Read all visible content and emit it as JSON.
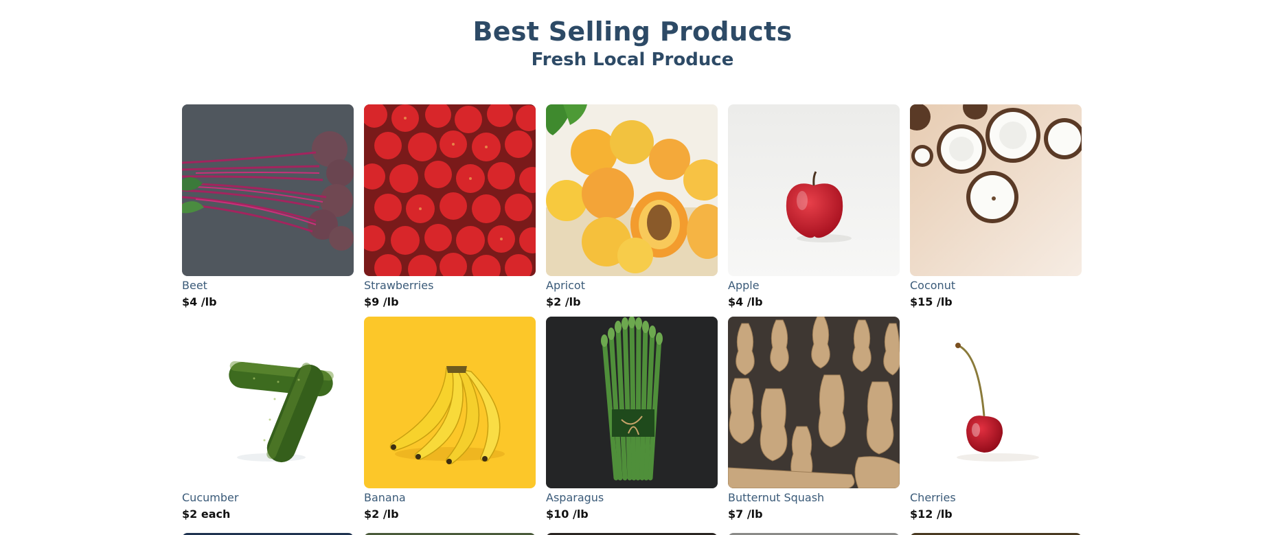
{
  "header": {
    "title": "Best Selling Products",
    "subtitle": "Fresh Local Produce"
  },
  "products": [
    {
      "name": "Beet",
      "price": "$4 /lb",
      "image": "beet-image"
    },
    {
      "name": "Strawberries",
      "price": "$9 /lb",
      "image": "strawberries-image"
    },
    {
      "name": "Apricot",
      "price": "$2 /lb",
      "image": "apricot-image"
    },
    {
      "name": "Apple",
      "price": "$4 /lb",
      "image": "apple-image"
    },
    {
      "name": "Coconut",
      "price": "$15 /lb",
      "image": "coconut-image"
    },
    {
      "name": "Cucumber",
      "price": "$2 each",
      "image": "cucumber-image"
    },
    {
      "name": "Banana",
      "price": "$2 /lb",
      "image": "banana-image"
    },
    {
      "name": "Asparagus",
      "price": "$10 /lb",
      "image": "asparagus-image"
    },
    {
      "name": "Butternut Squash",
      "price": "$7 /lb",
      "image": "butternut-squash-image"
    },
    {
      "name": "Cherries",
      "price": "$12 /lb",
      "image": "cherries-image"
    }
  ],
  "colors": {
    "heading": "#2d4a66",
    "product_name": "#3a5a78",
    "price": "#111111"
  }
}
